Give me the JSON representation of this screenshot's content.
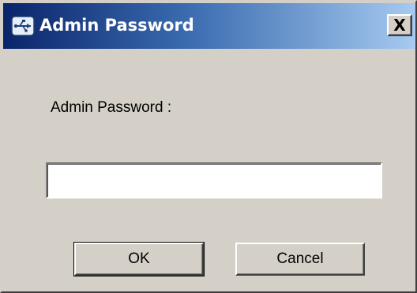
{
  "dialog": {
    "title": "Admin Password",
    "icon": "usb-device-icon",
    "close_label": "X",
    "prompt_label": "Admin Password :",
    "password_value": "",
    "ok_label": "OK",
    "cancel_label": "Cancel"
  },
  "colors": {
    "titlebar_start": "#0a246a",
    "titlebar_end": "#a6caf0",
    "dialog_face": "#d4d0c8"
  }
}
